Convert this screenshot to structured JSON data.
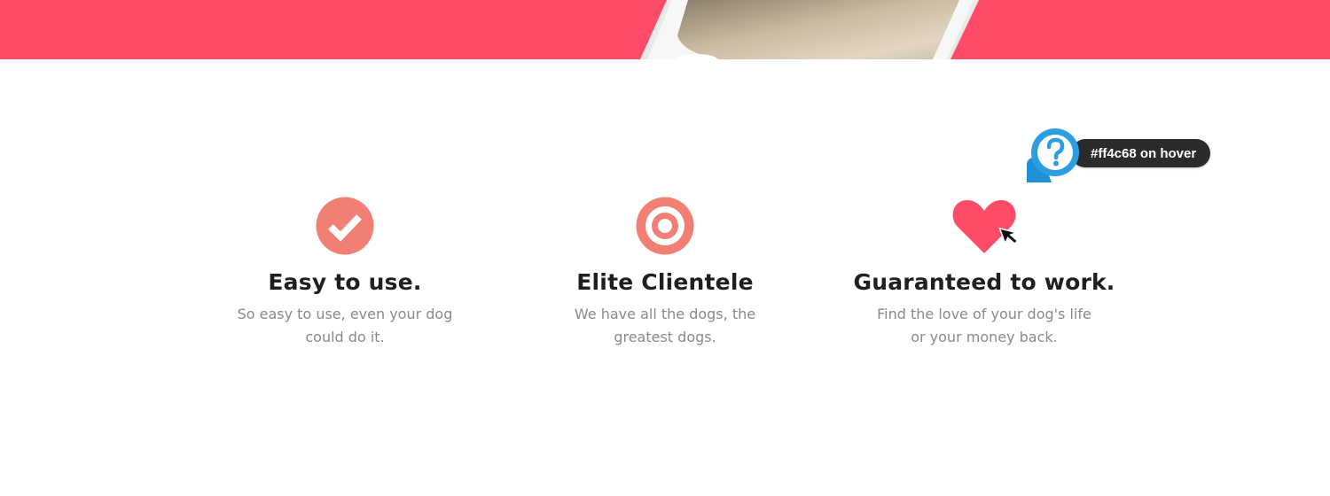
{
  "colors": {
    "brand": "#fe4c68",
    "icon_accent": "#f17f73",
    "heading": "#1f1f1f",
    "body_text": "#8a8a8a",
    "help_blue": "#2a9ee0"
  },
  "features": [
    {
      "icon": "checkmark-icon",
      "title": "Easy to use.",
      "description": "So easy to use, even your dog could do it."
    },
    {
      "icon": "target-icon",
      "title": "Elite Clientele",
      "description": "We have all the dogs, the greatest dogs."
    },
    {
      "icon": "heart-icon",
      "title": "Guaranteed to work.",
      "description": "Find the love of your dog's life or your money back."
    }
  ],
  "tooltip": {
    "icon": "help-question-icon",
    "text": "#ff4c68 on hover"
  }
}
